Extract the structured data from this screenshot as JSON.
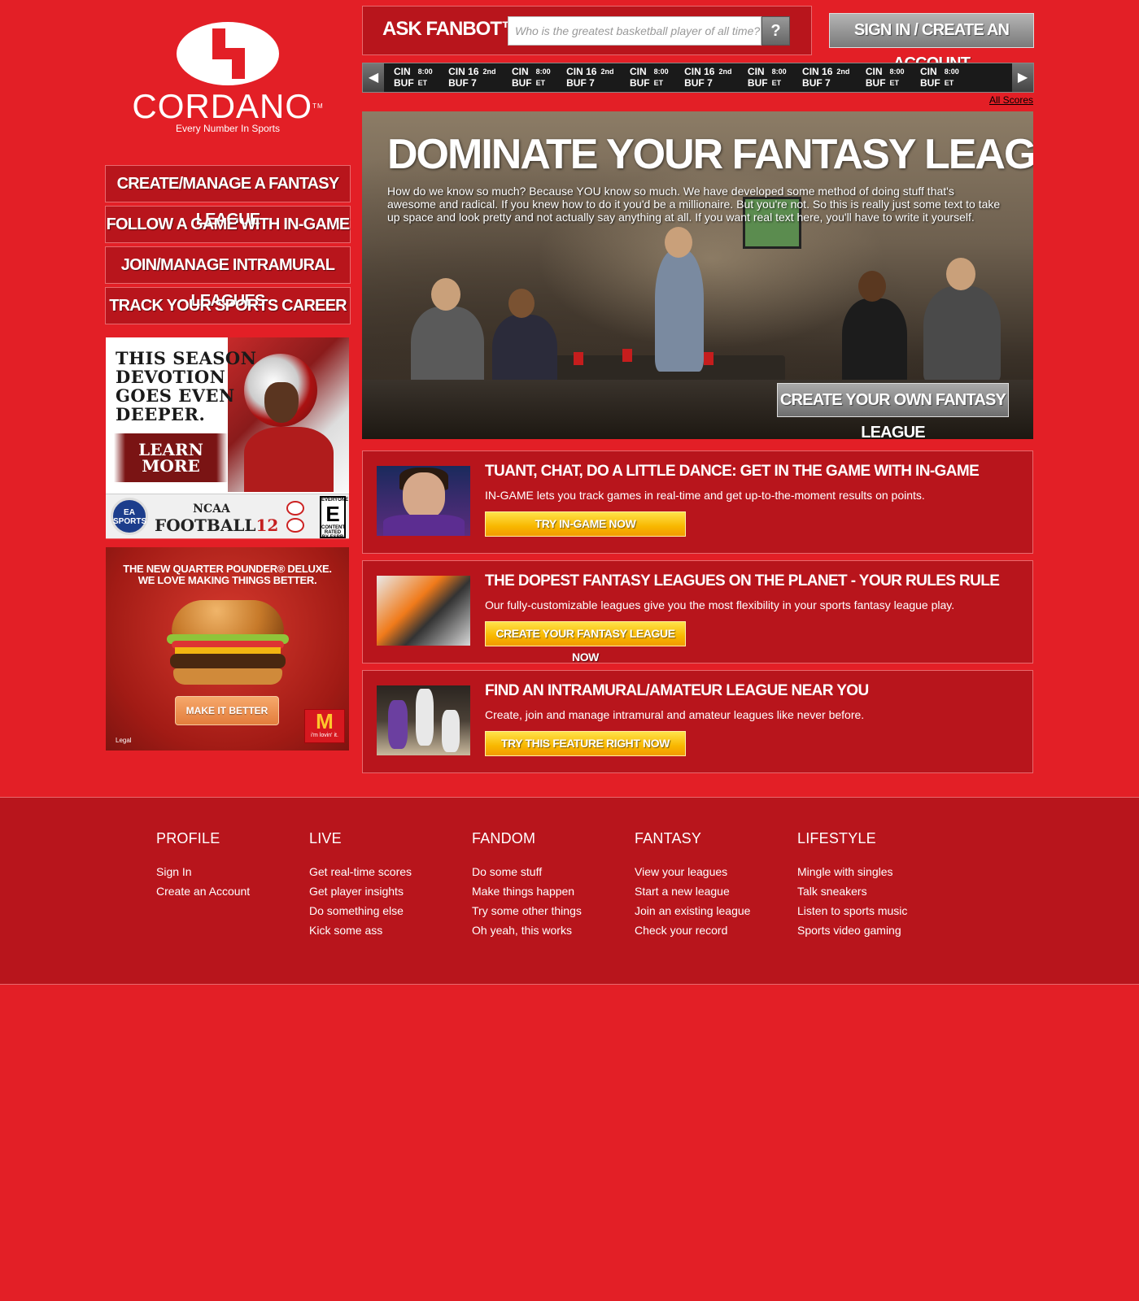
{
  "logo": {
    "brand": "CORDANO",
    "tm": "TM",
    "tagline": "Every Number In Sports"
  },
  "left_nav": [
    "Create/Manage a Fantasy League",
    "Follow a Game with In-Game",
    "Join/Manage Intramural Leagues",
    "Track Your Sports Career"
  ],
  "ad_ea": {
    "headline": [
      "THIS SEASON",
      "DEVOTION",
      "GOES EVEN",
      "DEEPER."
    ],
    "cta": [
      "LEARN",
      "MORE"
    ],
    "ea_logo": [
      "EA",
      "SPORTS"
    ],
    "game_title": [
      "NCAA",
      "FOOTBALL",
      "12"
    ],
    "rating": [
      "EVERYONE",
      "E",
      "CONTENT RATED BY ESRB"
    ]
  },
  "ad_mcd": {
    "headline": [
      "THE NEW QUARTER POUNDER® DELUXE.",
      "WE LOVE MAKING THINGS BETTER."
    ],
    "cta": "MAKE IT BETTER",
    "legal": "Legal",
    "logo_m": "M",
    "logo_slogan": "i'm lovin' it."
  },
  "fanbot": {
    "label": "ASK FANBOT™",
    "placeholder": "Who is the greatest basketball player of all time?",
    "button": "?"
  },
  "signin_label": "Sign In / Create an Account",
  "ticker": {
    "prev_arrow": "◀",
    "next_arrow": "▶",
    "games": [
      {
        "away": "CIN",
        "home": "BUF",
        "status_top": "8:00",
        "status_bottom": "ET"
      },
      {
        "away": "CIN 16",
        "home": "BUF 7",
        "status_top": "2nd",
        "status_bottom": ""
      },
      {
        "away": "CIN",
        "home": "BUF",
        "status_top": "8:00",
        "status_bottom": "ET"
      },
      {
        "away": "CIN 16",
        "home": "BUF 7",
        "status_top": "2nd",
        "status_bottom": ""
      },
      {
        "away": "CIN",
        "home": "BUF",
        "status_top": "8:00",
        "status_bottom": "ET"
      },
      {
        "away": "CIN 16",
        "home": "BUF 7",
        "status_top": "2nd",
        "status_bottom": ""
      },
      {
        "away": "CIN",
        "home": "BUF",
        "status_top": "8:00",
        "status_bottom": "ET"
      },
      {
        "away": "CIN 16",
        "home": "BUF 7",
        "status_top": "2nd",
        "status_bottom": ""
      },
      {
        "away": "CIN",
        "home": "BUF",
        "status_top": "8:00",
        "status_bottom": "ET"
      },
      {
        "away": "CIN",
        "home": "BUF",
        "status_top": "8:00",
        "status_bottom": "ET"
      }
    ],
    "all_scores": "All Scores"
  },
  "hero": {
    "title": "DOMINATE YOUR FANTASY LEAGUE",
    "copy": "How do we know so much? Because YOU know so much. We have developed some method of doing stuff that's awesome and radical. If you knew how to do it you'd be a millionaire. But you're not. So this is really just some text to take up space and look pretty and not actually say anything at all. If you want real text here, you'll have to write it yourself.",
    "cta": "Create Your Own Fantasy League"
  },
  "cards": [
    {
      "title": "Tuant, Chat, Do a Little Dance: Get in the Game with In-Game",
      "desc": "IN-GAME lets you track games in real-time and get up-to-the-moment results on points.",
      "button": "Try In-Game Now"
    },
    {
      "title": "The Dopest Fantasy Leagues on the Planet - Your Rules Rule",
      "desc": "Our fully-customizable leagues give you the most flexibility in your sports fantasy league play.",
      "button": "Create Your Fantasy League Now"
    },
    {
      "title": "Find an Intramural/Amateur League Near You",
      "desc": "Create, join and manage intramural and amateur leagues like never before.",
      "button": "Try This Feature Right Now"
    }
  ],
  "footer": [
    {
      "heading": "PROFILE",
      "links": [
        "Sign In",
        "Create an Account"
      ]
    },
    {
      "heading": "LIVE",
      "links": [
        "Get real-time scores",
        "Get player insights",
        "Do something else",
        "Kick some ass"
      ]
    },
    {
      "heading": "FANDOM",
      "links": [
        "Do some stuff",
        "Make things happen",
        "Try some other things",
        "Oh yeah, this works"
      ]
    },
    {
      "heading": "FANTASY",
      "links": [
        "View your leagues",
        "Start a new league",
        "Join an existing league",
        "Check your record"
      ]
    },
    {
      "heading": "LIFESTYLE",
      "links": [
        "Mingle with singles",
        "Talk sneakers",
        "Listen to sports music",
        "Sports video gaming"
      ]
    }
  ],
  "colors": {
    "page_bg": "#e31f26",
    "panel_bg": "#b8151c",
    "panel_border": "#e86a6e",
    "cta_yellow": "#f8b700"
  }
}
